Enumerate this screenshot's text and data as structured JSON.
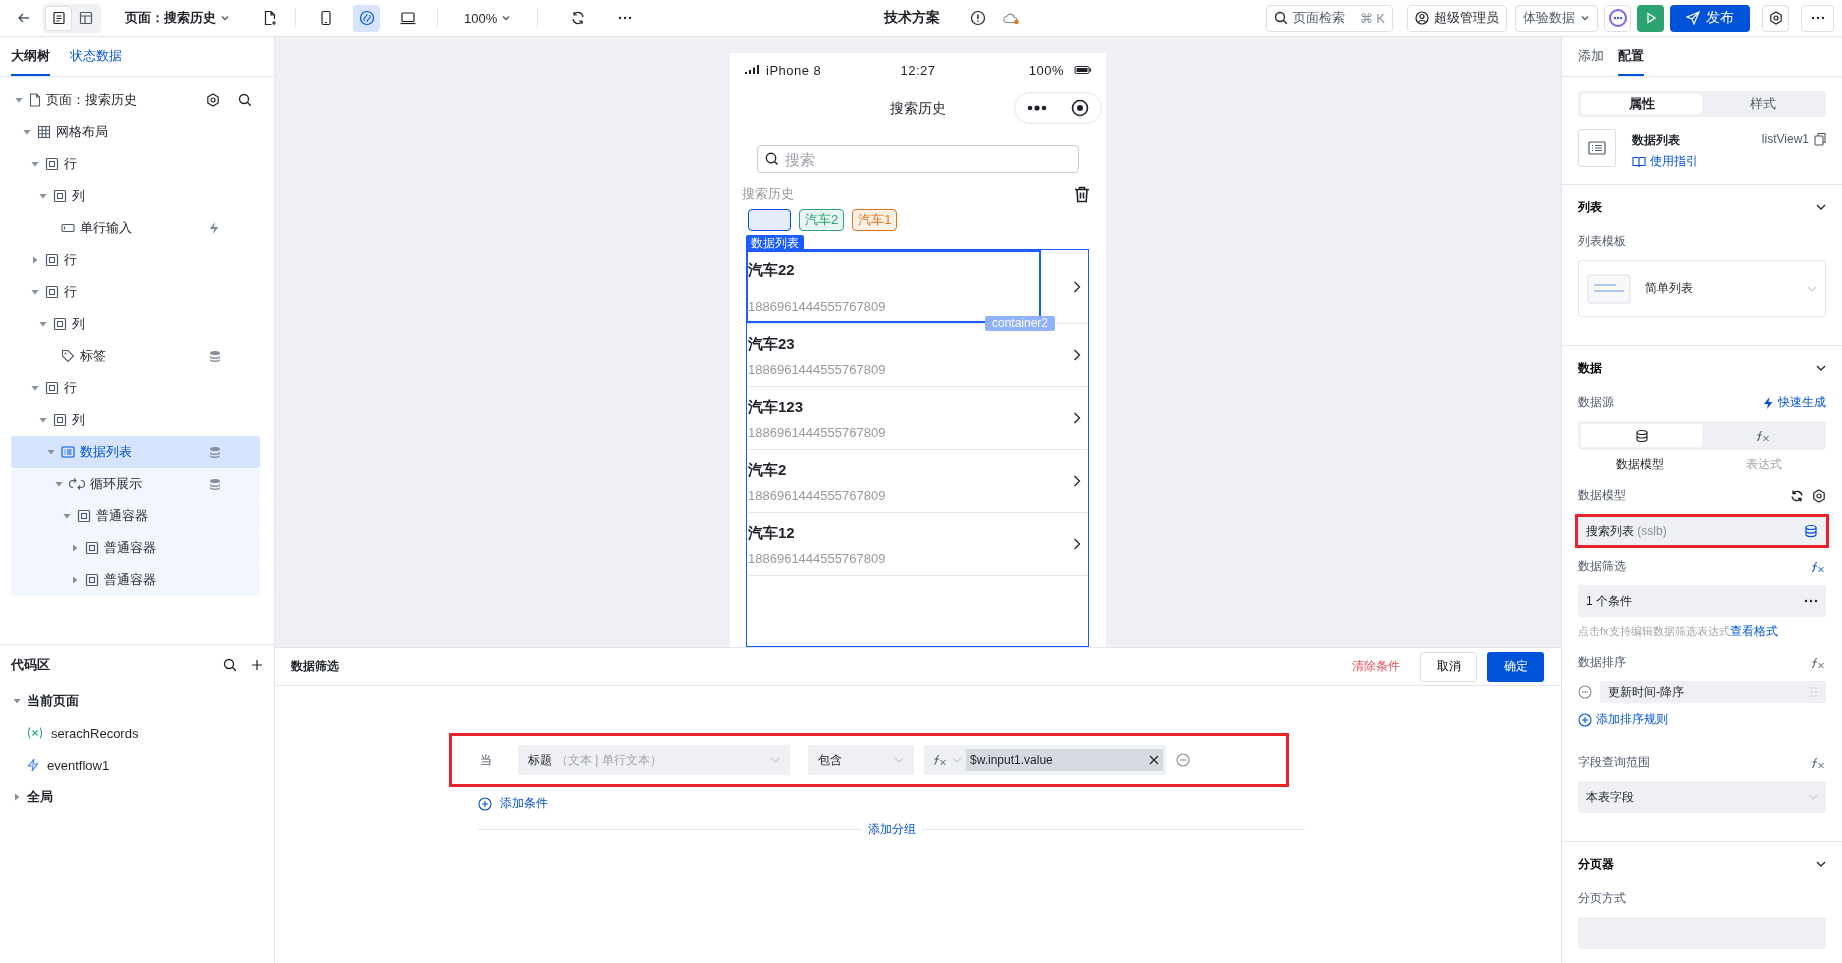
{
  "toolbar": {
    "view_modes": [
      {
        "kind": "outline",
        "selected": true
      },
      {
        "kind": "layout",
        "selected": false
      }
    ],
    "page_selector": "页面：搜索历史",
    "devices": [
      {
        "kind": "mobile",
        "selected": false
      },
      {
        "kind": "miniprogram",
        "selected": true
      },
      {
        "kind": "desktop",
        "selected": false
      }
    ],
    "zoom": "100%",
    "title": "技术方案",
    "search": {
      "label": "页面检索",
      "shortcut": "⌘ K"
    },
    "user": "超级管理员",
    "data_mode": "体验数据",
    "publish": "发布"
  },
  "left_panel": {
    "tabs": [
      {
        "label": "大纲树",
        "selected": true
      },
      {
        "label": "状态数据",
        "selected": false
      }
    ],
    "tree": [
      {
        "label": "页面：搜索历史",
        "kind": "page",
        "expanded": true,
        "selected": false,
        "children": [
          {
            "label": "网格布局",
            "kind": "grid",
            "expanded": true,
            "selected": false,
            "children": [
              {
                "label": "行",
                "kind": "box",
                "expanded": true,
                "selected": false,
                "children": [
                  {
                    "label": "列",
                    "kind": "box",
                    "expanded": true,
                    "selected": false,
                    "children": [
                      {
                        "label": "单行输入",
                        "kind": "input",
                        "event_bound": true,
                        "selected": false
                      }
                    ]
                  }
                ]
              },
              {
                "label": "行",
                "kind": "box",
                "expanded": false,
                "selected": false
              },
              {
                "label": "行",
                "kind": "box",
                "expanded": true,
                "selected": false,
                "children": [
                  {
                    "label": "列",
                    "kind": "box",
                    "expanded": true,
                    "selected": false,
                    "children": [
                      {
                        "label": "标签",
                        "kind": "tag",
                        "data_bound": true,
                        "selected": false
                      }
                    ]
                  }
                ]
              },
              {
                "label": "行",
                "kind": "box",
                "expanded": true,
                "selected": false,
                "children": [
                  {
                    "label": "列",
                    "kind": "box",
                    "expanded": true,
                    "selected": false,
                    "children": [
                      {
                        "label": "数据列表",
                        "kind": "list",
                        "data_bound": true,
                        "expanded": true,
                        "selected": true,
                        "children": [
                          {
                            "label": "循环展示",
                            "kind": "loop",
                            "data_bound": true,
                            "expanded": true,
                            "selected": false,
                            "children": [
                              {
                                "label": "普通容器",
                                "kind": "box",
                                "expanded": true,
                                "selected": false,
                                "children": [
                                  {
                                    "label": "普通容器",
                                    "kind": "box",
                                    "expanded": false,
                                    "selected": false
                                  },
                                  {
                                    "label": "普通容器",
                                    "kind": "box",
                                    "expanded": false,
                                    "selected": false
                                  }
                                ]
                              }
                            ]
                          }
                        ]
                      }
                    ]
                  }
                ]
              }
            ]
          }
        ]
      }
    ],
    "code_area": {
      "title": "代码区",
      "groups": [
        {
          "label": "当前页面",
          "expanded": true,
          "items": [
            {
              "label": "serachRecords",
              "kind": "variable"
            },
            {
              "label": "eventflow1",
              "kind": "eventflow"
            }
          ]
        },
        {
          "label": "全局",
          "expanded": false
        }
      ]
    }
  },
  "phone": {
    "carrier": "iPhone 8",
    "time": "12:27",
    "battery": "100%",
    "nav_title": "搜索历史",
    "search_placeholder": "搜索",
    "history_label": "搜索历史",
    "tags": [
      {
        "color": "#0052d9"
      },
      {
        "text": "汽车2",
        "color": "#2ba471"
      },
      {
        "text": "汽车1",
        "color": "#e37318"
      }
    ],
    "selection_label": "数据列表",
    "hover_label": "container2",
    "items": [
      {
        "title": "汽车22",
        "subtitle": "1886961444555767809",
        "highlighted": true
      },
      {
        "title": "汽车23",
        "subtitle": "1886961444555767809",
        "highlighted": false
      },
      {
        "title": "汽车123",
        "subtitle": "1886961444555767809",
        "highlighted": false
      },
      {
        "title": "汽车2",
        "subtitle": "1886961444555767809",
        "highlighted": false
      },
      {
        "title": "汽车12",
        "subtitle": "1886961444555767809",
        "highlighted": false
      }
    ]
  },
  "filter_panel": {
    "title": "数据筛选",
    "clear": "清除条件",
    "cancel": "取消",
    "confirm": "确定",
    "conditions": [
      {
        "prefix": "当",
        "field": "标题",
        "field_hint": "（文本 | 单行文本）",
        "operator": "包含",
        "value": "$w.input1.value",
        "highlighted": true
      }
    ],
    "add_condition": "添加条件",
    "add_group": "添加分组"
  },
  "right_panel": {
    "tabs": [
      {
        "label": "添加",
        "selected": false
      },
      {
        "label": "配置",
        "selected": true
      }
    ],
    "modes": [
      {
        "label": "属性",
        "selected": true
      },
      {
        "label": "样式",
        "selected": false
      }
    ],
    "component": {
      "name": "数据列表",
      "guide": "使用指引",
      "id": "listView1"
    },
    "sections": [
      {
        "kind": "list",
        "title": "列表",
        "expanded": true,
        "template_label": "列表模板",
        "template": "简单列表"
      },
      {
        "kind": "data",
        "title": "数据",
        "expanded": true,
        "source_label": "数据源",
        "quick_generate": "快速生成",
        "source_options": [
          {
            "kind": "model",
            "label": "数据模型",
            "selected": true
          },
          {
            "kind": "expression",
            "label": "表达式",
            "selected": false
          }
        ],
        "model_label": "数据模型",
        "model": "搜索列表",
        "model_hint": "(sslb)",
        "model_highlighted": true,
        "filter_label": "数据筛选",
        "filter_value": "1 个条件",
        "filter_help": "点击fx支持编辑数据筛选表达式",
        "filter_help_link": "查看格式",
        "sort_label": "数据排序",
        "sort_rules": [
          "更新时间-降序"
        ],
        "add_sort": "添加排序规则",
        "scope_label": "字段查询范围",
        "scope": "本表字段"
      },
      {
        "kind": "pager",
        "title": "分页器",
        "expanded": true,
        "mode_label": "分页方式"
      }
    ]
  }
}
